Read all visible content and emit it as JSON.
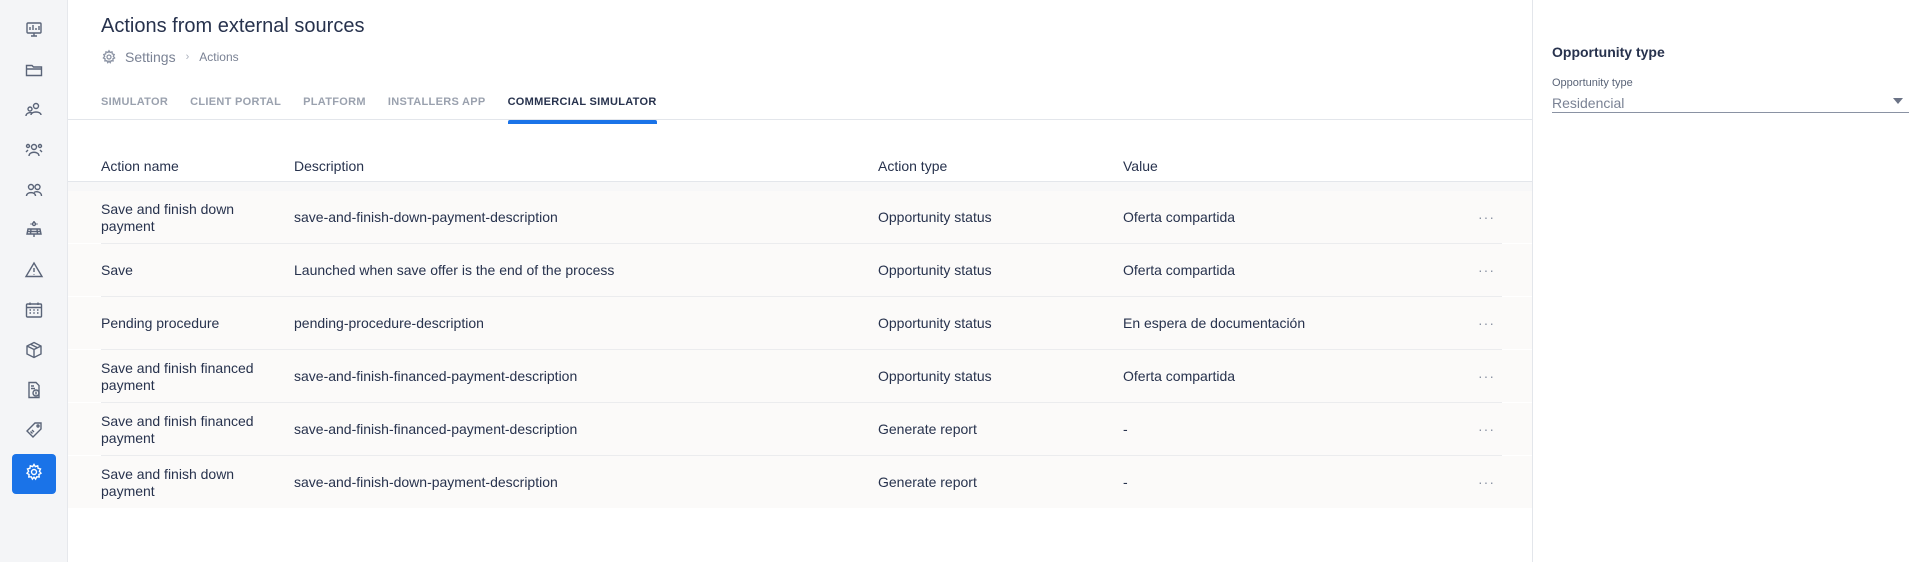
{
  "sidebar": {
    "items": [
      {
        "icon": "dashboard-icon"
      },
      {
        "icon": "folder-icon"
      },
      {
        "icon": "contacts-icon"
      },
      {
        "icon": "team-icon"
      },
      {
        "icon": "users-icon"
      },
      {
        "icon": "solar-panel-icon"
      },
      {
        "icon": "warning-icon"
      },
      {
        "icon": "calendar-icon"
      },
      {
        "icon": "box-icon"
      },
      {
        "icon": "invoice-icon"
      },
      {
        "icon": "tag-icon"
      },
      {
        "icon": "settings-icon",
        "active": true
      }
    ]
  },
  "header": {
    "title": "Actions from external sources",
    "breadcrumb": {
      "root": "Settings",
      "current": "Actions"
    }
  },
  "tabs": [
    {
      "label": "SIMULATOR",
      "active": false
    },
    {
      "label": "CLIENT PORTAL",
      "active": false
    },
    {
      "label": "PLATFORM",
      "active": false
    },
    {
      "label": "INSTALLERS APP",
      "active": false
    },
    {
      "label": "COMMERCIAL SIMULATOR",
      "active": true
    }
  ],
  "table": {
    "columns": [
      "Action name",
      "Description",
      "Action type",
      "Value"
    ],
    "rows": [
      {
        "name": "Save and finish down payment",
        "description": "save-and-finish-down-payment-description",
        "type": "Opportunity status",
        "value": "Oferta compartida"
      },
      {
        "name": "Save",
        "description": "Launched when save offer is the end of the process",
        "type": "Opportunity status",
        "value": "Oferta compartida"
      },
      {
        "name": "Pending procedure",
        "description": "pending-procedure-description",
        "type": "Opportunity status",
        "value": "En espera de documentación"
      },
      {
        "name": "Save and finish financed payment",
        "description": "save-and-finish-financed-payment-description",
        "type": "Opportunity status",
        "value": "Oferta compartida"
      },
      {
        "name": "Save and finish financed payment",
        "description": "save-and-finish-financed-payment-description",
        "type": "Generate report",
        "value": "-"
      },
      {
        "name": "Save and finish down payment",
        "description": "save-and-finish-down-payment-description",
        "type": "Generate report",
        "value": "-"
      }
    ],
    "row_menu_label": "···"
  },
  "panel": {
    "title": "Opportunity type",
    "field_label": "Opportunity type",
    "field_value": "Residencial"
  },
  "colors": {
    "accent": "#1a73e8",
    "text": "#27324d",
    "muted": "#8a92a3"
  }
}
